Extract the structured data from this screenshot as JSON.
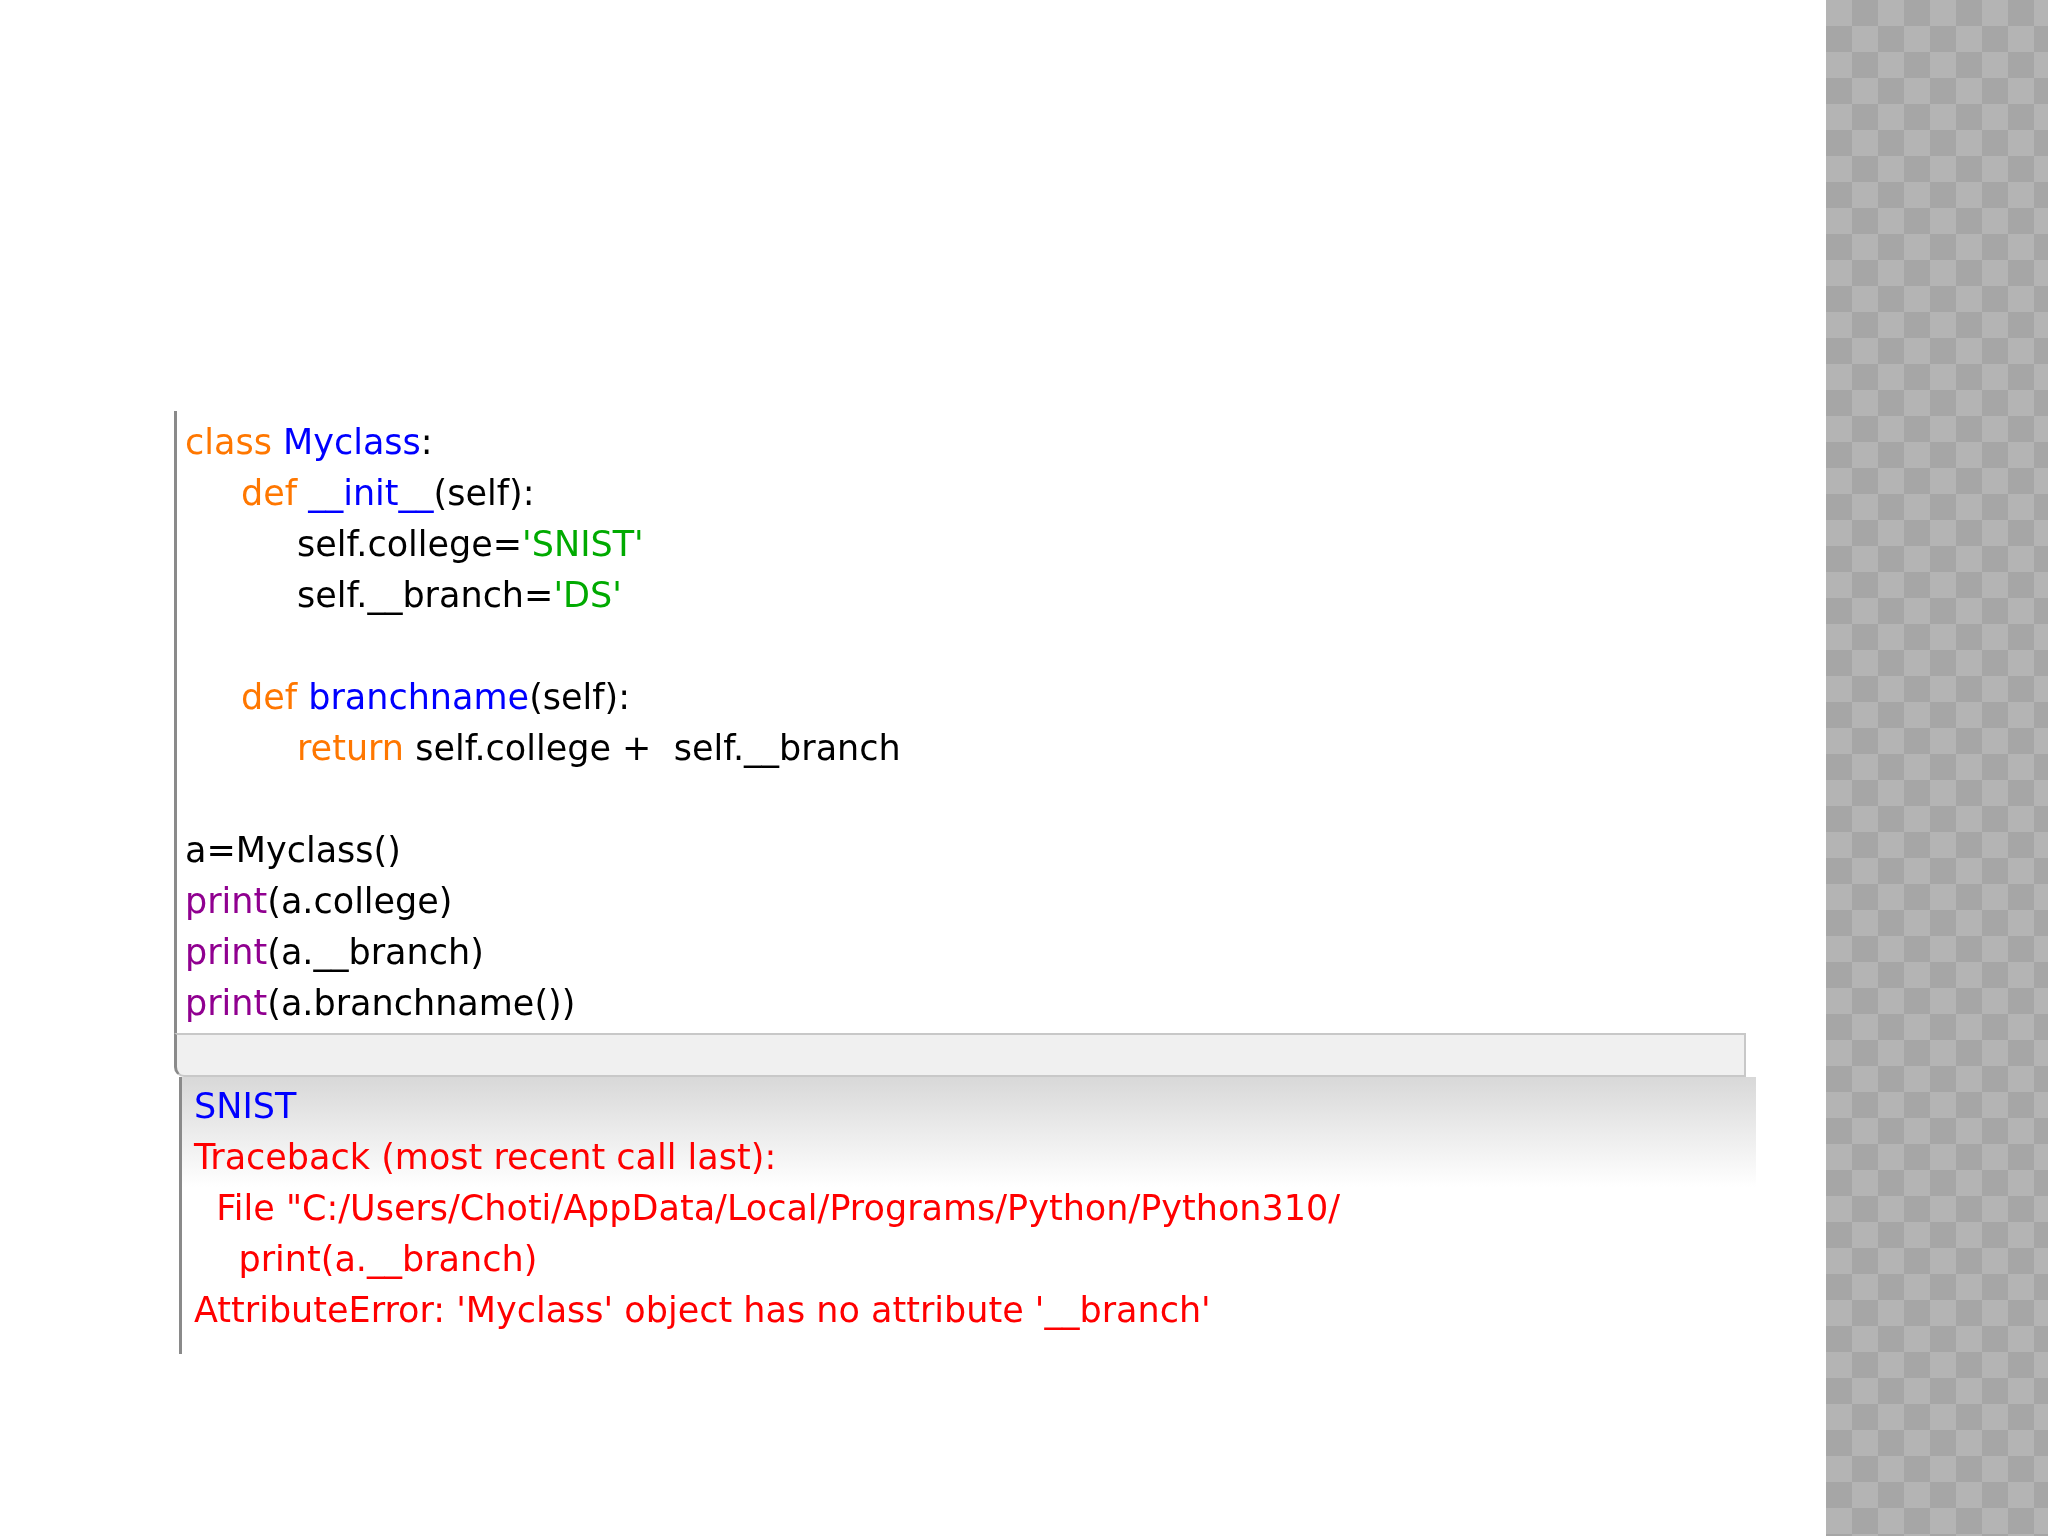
{
  "editor": {
    "lines": [
      {
        "kind": "code",
        "tokens": [
          {
            "kind": "keyword",
            "text": "class "
          },
          {
            "kind": "definition",
            "text": "Myclass"
          },
          {
            "kind": "plain",
            "text": ":"
          }
        ],
        "children": [
          {
            "kind": "code",
            "tokens": [
              {
                "kind": "keyword",
                "text": "def "
              },
              {
                "kind": "definition",
                "text": "__init__"
              },
              {
                "kind": "plain",
                "text": "(self):"
              }
            ],
            "children": [
              {
                "kind": "code",
                "tokens": [
                  {
                    "kind": "plain",
                    "text": "self.college="
                  },
                  {
                    "kind": "string",
                    "text": "'SNIST'"
                  }
                ]
              },
              {
                "kind": "code",
                "tokens": [
                  {
                    "kind": "plain",
                    "text": "self.__branch="
                  },
                  {
                    "kind": "string",
                    "text": "'DS'"
                  }
                ]
              }
            ]
          },
          {
            "kind": "blank"
          },
          {
            "kind": "code",
            "tokens": [
              {
                "kind": "keyword",
                "text": "def "
              },
              {
                "kind": "definition",
                "text": "branchname"
              },
              {
                "kind": "plain",
                "text": "(self):"
              }
            ],
            "children": [
              {
                "kind": "code",
                "tokens": [
                  {
                    "kind": "keyword",
                    "text": "return "
                  },
                  {
                    "kind": "plain",
                    "text": "self.college +  self.__branch"
                  }
                ]
              }
            ]
          }
        ]
      },
      {
        "kind": "blank"
      },
      {
        "kind": "code",
        "tokens": [
          {
            "kind": "plain",
            "text": "a=Myclass()"
          }
        ]
      },
      {
        "kind": "code",
        "tokens": [
          {
            "kind": "builtin",
            "text": "print"
          },
          {
            "kind": "plain",
            "text": "(a.college)"
          }
        ]
      },
      {
        "kind": "code",
        "tokens": [
          {
            "kind": "builtin",
            "text": "print"
          },
          {
            "kind": "plain",
            "text": "(a.__branch)"
          }
        ]
      },
      {
        "kind": "code",
        "tokens": [
          {
            "kind": "builtin",
            "text": "print"
          },
          {
            "kind": "plain",
            "text": "(a.branchname())"
          }
        ]
      }
    ]
  },
  "shell": {
    "lines": [
      {
        "kind": "stdout",
        "text": "SNIST"
      },
      {
        "kind": "stderr",
        "text": "Traceback (most recent call last):"
      },
      {
        "kind": "stderr",
        "text": "  File \"C:/Users/Choti/AppData/Local/Programs/Python/Python310/"
      },
      {
        "kind": "stderr",
        "text": "    print(a.__branch)"
      },
      {
        "kind": "stderr",
        "text": "AttributeError: 'Myclass' object has no attribute '__branch'"
      }
    ]
  }
}
